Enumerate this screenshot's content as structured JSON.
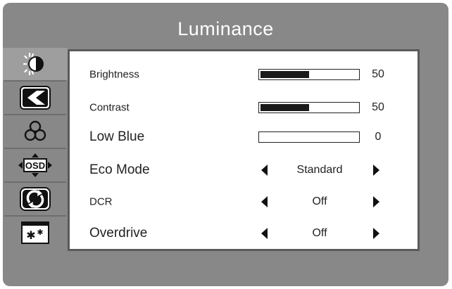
{
  "header": {
    "title": "Luminance"
  },
  "sidebar": {
    "items": [
      {
        "icon": "luminance-icon",
        "selected": true
      },
      {
        "icon": "image-setup-icon",
        "selected": false
      },
      {
        "icon": "color-setup-icon",
        "selected": false
      },
      {
        "icon": "osd-setup-icon",
        "selected": false,
        "text": "OSD"
      },
      {
        "icon": "reset-icon",
        "selected": false
      },
      {
        "icon": "misc-icon",
        "selected": false
      }
    ]
  },
  "settings": {
    "brightness": {
      "label": "Brightness",
      "value": "50",
      "level_percent": 50
    },
    "contrast": {
      "label": "Contrast",
      "value": "50",
      "level_percent": 50
    },
    "low_blue": {
      "label": "Low Blue",
      "value": "0",
      "level_percent": 0
    },
    "eco_mode": {
      "label": "Eco Mode",
      "option": "Standard"
    },
    "dcr": {
      "label": "DCR",
      "option": "Off"
    },
    "overdrive": {
      "label": "Overdrive",
      "option": "Off"
    }
  },
  "colors": {
    "background": "#888888",
    "panel": "#ffffff",
    "bar_fill": "#1a1a1a",
    "selected_item": "#9e9e9e"
  }
}
